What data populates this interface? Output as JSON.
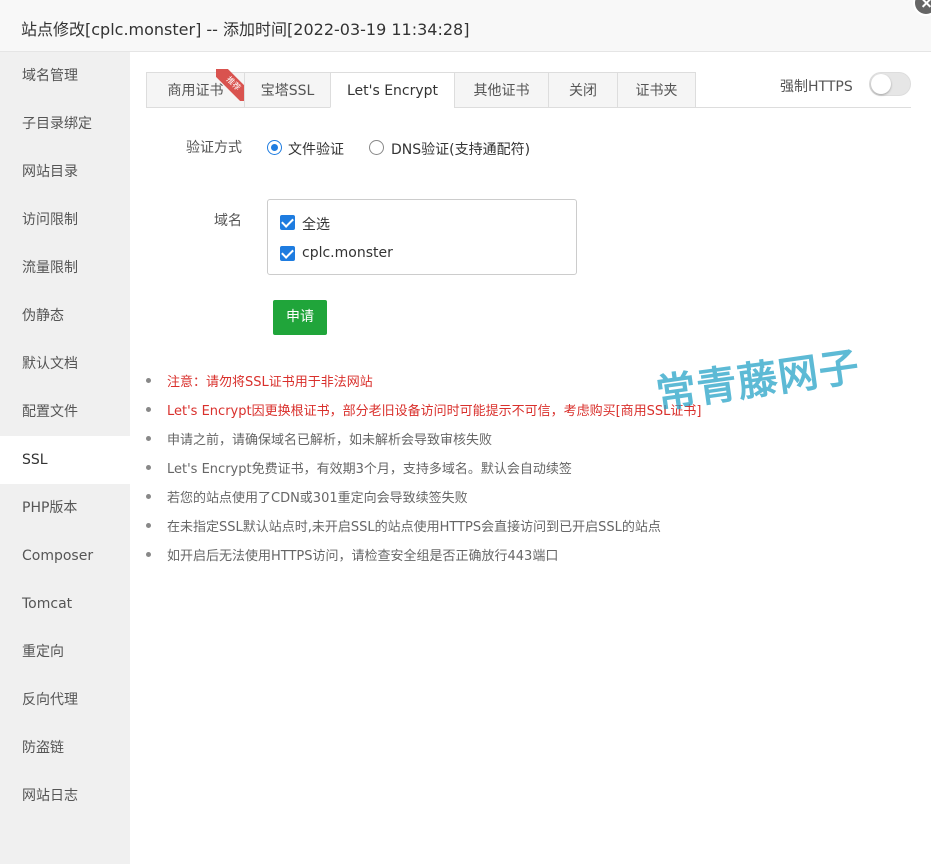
{
  "dialog": {
    "title": "站点修改[cplc.monster] -- 添加时间[2022-03-19 11:34:28]"
  },
  "sidebar": {
    "items": [
      {
        "label": "域名管理"
      },
      {
        "label": "子目录绑定"
      },
      {
        "label": "网站目录"
      },
      {
        "label": "访问限制"
      },
      {
        "label": "流量限制"
      },
      {
        "label": "伪静态"
      },
      {
        "label": "默认文档"
      },
      {
        "label": "配置文件"
      },
      {
        "label": "SSL"
      },
      {
        "label": "PHP版本"
      },
      {
        "label": "Composer"
      },
      {
        "label": "Tomcat"
      },
      {
        "label": "重定向"
      },
      {
        "label": "反向代理"
      },
      {
        "label": "防盗链"
      },
      {
        "label": "网站日志"
      }
    ],
    "active": "SSL"
  },
  "tabs": {
    "items": [
      {
        "label": "商用证书",
        "badge": "推荐"
      },
      {
        "label": "宝塔SSL"
      },
      {
        "label": "Let's Encrypt"
      },
      {
        "label": "其他证书"
      },
      {
        "label": "关闭"
      },
      {
        "label": "证书夹"
      }
    ],
    "active": "Let's Encrypt"
  },
  "force_https": {
    "label": "强制HTTPS",
    "enabled": false
  },
  "verify": {
    "label": "验证方式",
    "options": [
      {
        "label": "文件验证",
        "checked": true
      },
      {
        "label": "DNS验证(支持通配符)",
        "checked": false
      }
    ]
  },
  "domains": {
    "label": "域名",
    "items": [
      {
        "label": "全选",
        "checked": true
      },
      {
        "label": "cplc.monster",
        "checked": true
      }
    ]
  },
  "apply_button": {
    "label": "申请"
  },
  "notes": [
    {
      "text": "注意：请勿将SSL证书用于非法网站",
      "color": "red"
    },
    {
      "text": "Let's Encrypt因更换根证书，部分老旧设备访问时可能提示不可信，考虑购买[商用SSL证书]",
      "color": "red"
    },
    {
      "text": "申请之前，请确保域名已解析，如未解析会导致审核失败",
      "color": "gray"
    },
    {
      "text": "Let's Encrypt免费证书，有效期3个月，支持多域名。默认会自动续签",
      "color": "gray"
    },
    {
      "text": "若您的站点使用了CDN或301重定向会导致续签失败",
      "color": "gray"
    },
    {
      "text": "在未指定SSL默认站点时,未开启SSL的站点使用HTTPS会直接访问到已开启SSL的站点",
      "color": "gray"
    },
    {
      "text": "如开启后无法使用HTTPS访问，请检查安全组是否正确放行443端口",
      "color": "gray"
    }
  ],
  "watermark": {
    "text": "常青藤网子"
  },
  "colors": {
    "accent": "#20a53a",
    "link": "#1e7ce0",
    "warning": "#d9302c"
  }
}
